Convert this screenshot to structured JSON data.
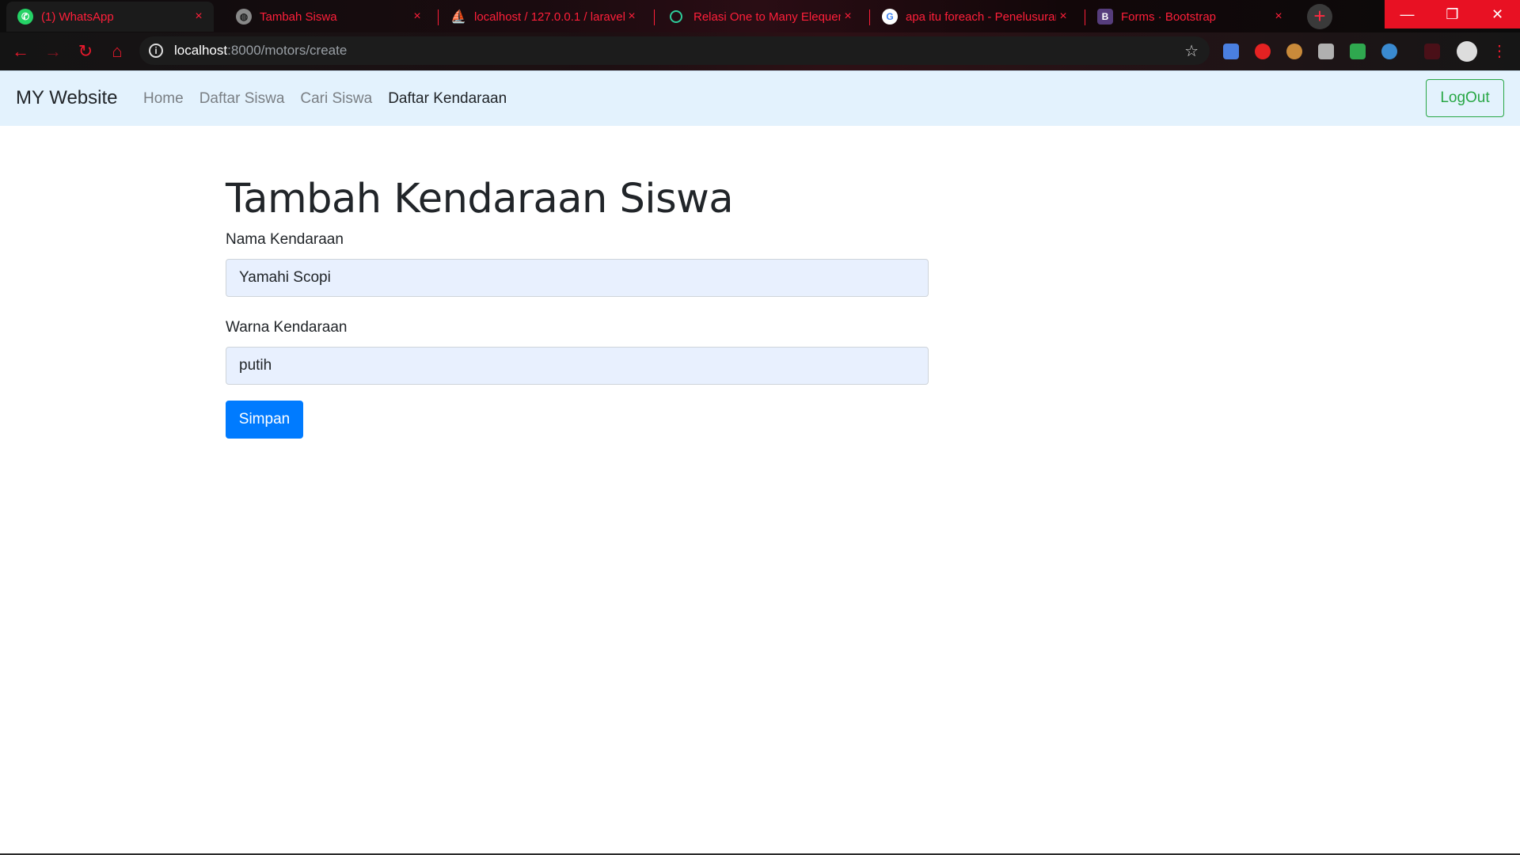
{
  "browser": {
    "tabs": [
      {
        "title": "(1) WhatsApp",
        "icon": "whatsapp-icon"
      },
      {
        "title": "Tambah Siswa",
        "icon": "globe-icon"
      },
      {
        "title": "localhost / 127.0.0.1 / laravel",
        "icon": "phpmyadmin-icon"
      },
      {
        "title": "Relasi One to Many Elequent",
        "icon": "loading-icon"
      },
      {
        "title": "apa itu foreach - Penelusuran",
        "icon": "google-icon"
      },
      {
        "title": "Forms · Bootstrap",
        "icon": "bootstrap-icon"
      }
    ],
    "close_glyph": "×",
    "new_tab_glyph": "+",
    "url_host": "localhost",
    "url_path": ":8000/motors/create",
    "accent_color": "#ff1f3a"
  },
  "navbar": {
    "brand": "MY Website",
    "links": [
      "Home",
      "Daftar Siswa",
      "Cari Siswa",
      "Daftar Kendaraan"
    ],
    "active_link": "Daftar Kendaraan",
    "logout_label": "LogOut"
  },
  "form": {
    "title": "Tambah Kendaraan Siswa",
    "name_label": "Nama Kendaraan",
    "name_value": "Yamahi Scopi",
    "color_label": "Warna Kendaraan",
    "color_value": "putih",
    "submit_label": "Simpan"
  }
}
